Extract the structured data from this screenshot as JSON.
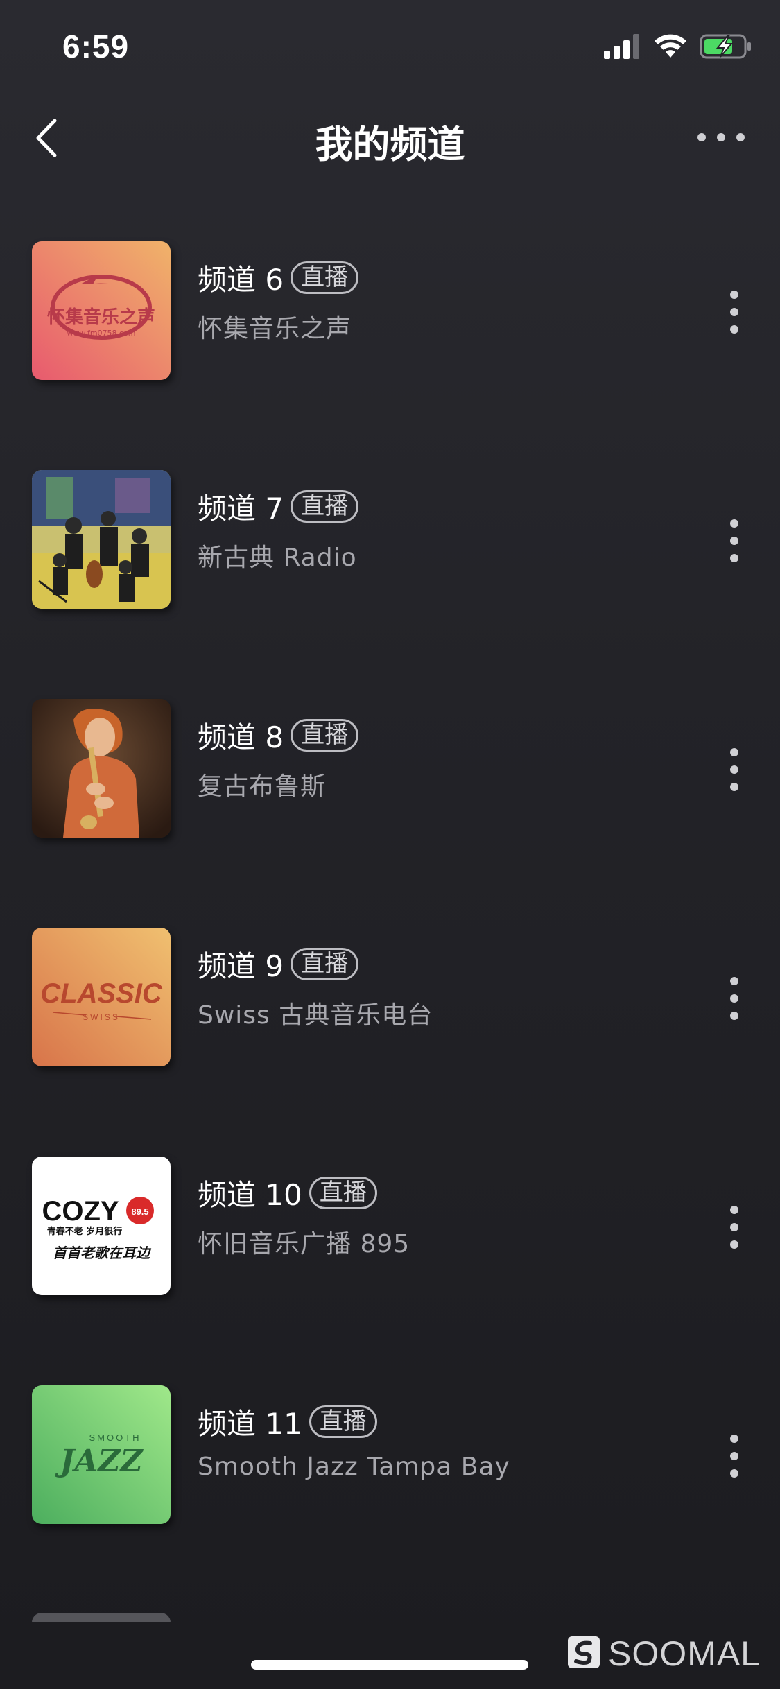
{
  "status_bar": {
    "time": "6:59",
    "icons": [
      "signal-icon",
      "wifi-icon",
      "battery-charging-icon"
    ]
  },
  "nav": {
    "title": "我的频道",
    "back_icon": "chevron-left-icon",
    "more_icon": "more-horizontal-icon"
  },
  "channels": [
    {
      "title": "频道 6",
      "badge": "直播",
      "subtitle": "怀集音乐之声",
      "cover_icon": "cover-huaiji-radio",
      "cover_logo_text": "怀集音乐之声",
      "cover_logo_url": "www.fm0758.com"
    },
    {
      "title": "频道 7",
      "badge": "直播",
      "subtitle": "新古典 Radio",
      "cover_icon": "cover-orchestra-painting"
    },
    {
      "title": "频道 8",
      "badge": "直播",
      "subtitle": "复古布鲁斯",
      "cover_icon": "cover-saxophone-player"
    },
    {
      "title": "频道 9",
      "badge": "直播",
      "subtitle": "Swiss 古典音乐电台",
      "cover_icon": "cover-classic-swiss",
      "cover_logo_text": "CLASSIC",
      "cover_logo_sub": "SWISS"
    },
    {
      "title": "频道 10",
      "badge": "直播",
      "subtitle": "怀旧音乐广播 895",
      "cover_icon": "cover-cozy-895",
      "cover_logo_text": "COZY",
      "cover_logo_freq": "89.5",
      "cover_logo_tag": "青春不老 岁月很行",
      "cover_logo_slogan": "首首老歌在耳边"
    },
    {
      "title": "频道 11",
      "badge": "直播",
      "subtitle": "Smooth Jazz Tampa Bay",
      "cover_icon": "cover-smooth-jazz",
      "cover_logo_text": "JAZZ",
      "cover_logo_sub": "SMOOTH"
    }
  ],
  "watermark": {
    "text": "SOOMAL",
    "icon": "soomal-logo-icon"
  },
  "colors": {
    "background": "#232328",
    "text_primary": "#ffffff",
    "text_secondary": "#a8a8ae",
    "battery_green": "#4cd964"
  }
}
